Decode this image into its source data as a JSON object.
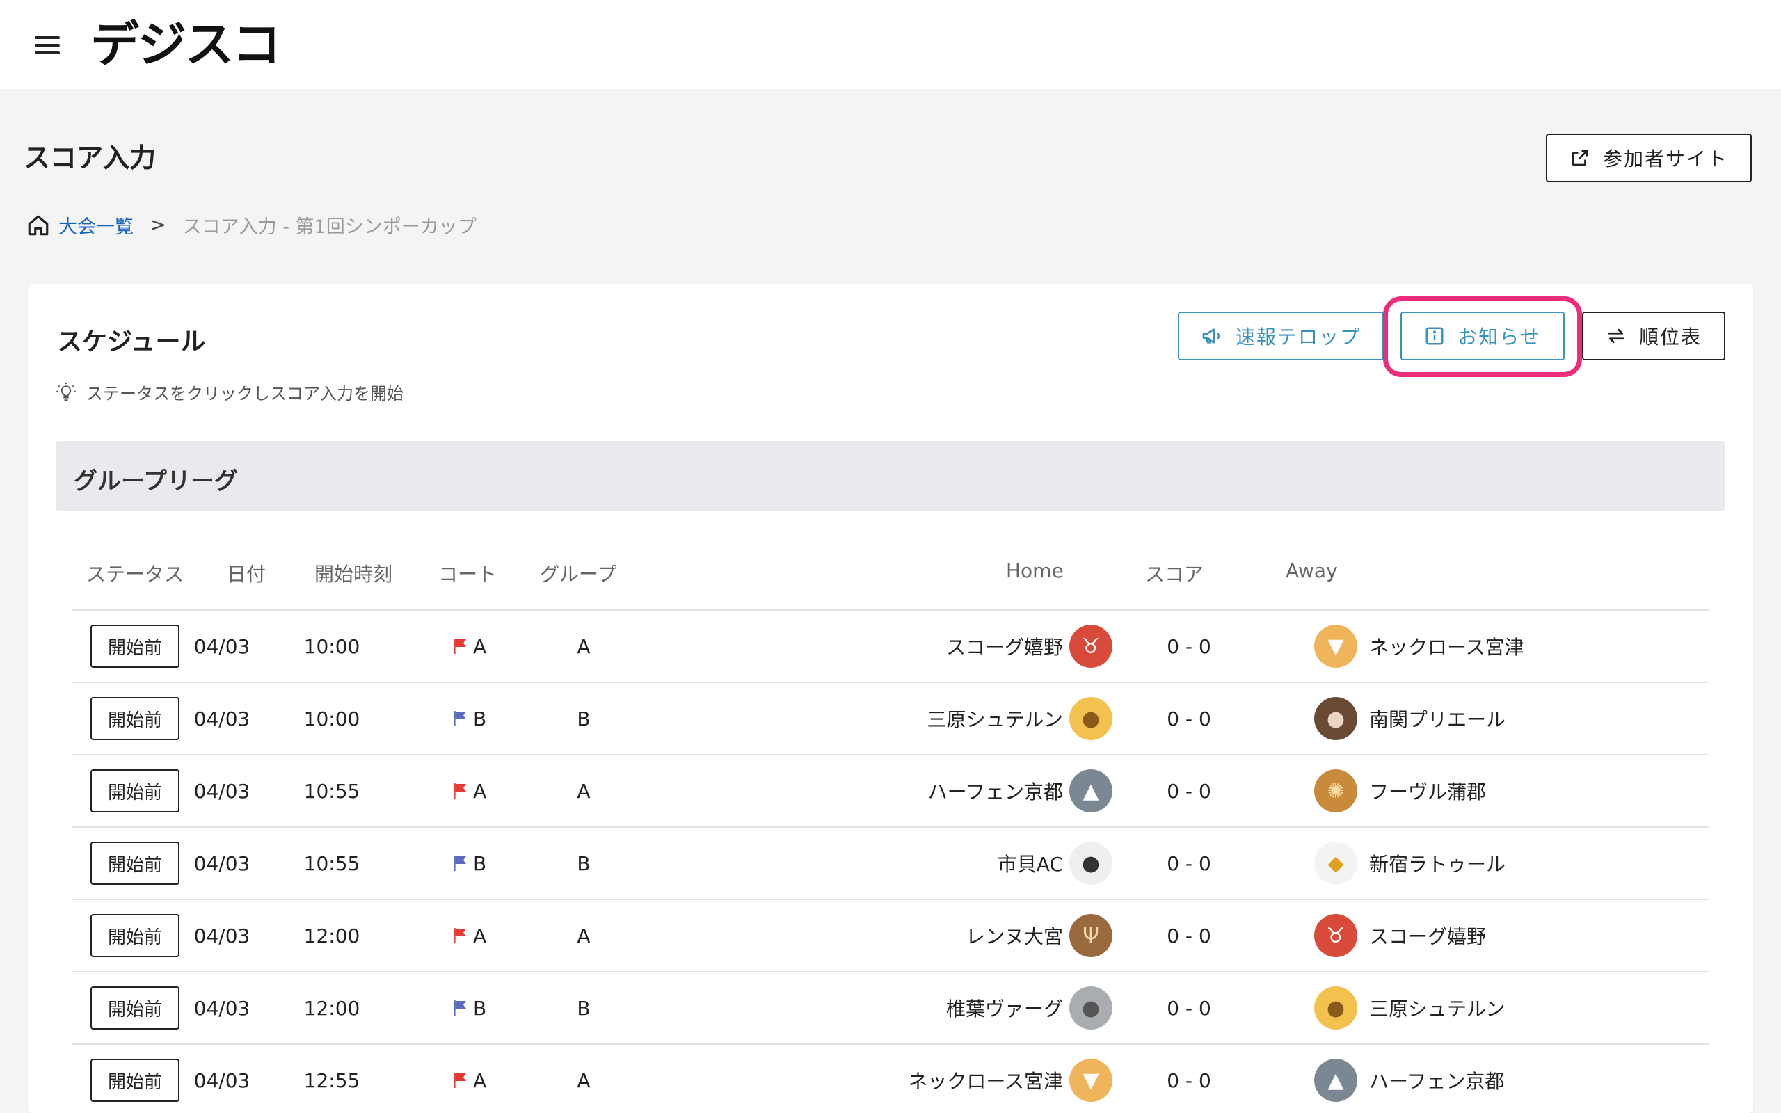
{
  "app": {
    "logo_text": "デジスコ",
    "menu_icon": "hamburger-menu-icon"
  },
  "page": {
    "title": "スコア入力",
    "participant_button": "参加者サイト"
  },
  "breadcrumb": {
    "home": "大会一覧",
    "separator": ">",
    "current": "スコア入力 - 第1回シンポーカップ"
  },
  "schedule": {
    "title": "スケジュール",
    "hint": "ステータスをクリックしスコア入力を開始",
    "buttons": {
      "telop": "速報テロップ",
      "notice": "お知らせ",
      "standings": "順位表"
    },
    "group_title": "グループリーグ",
    "columns": {
      "status": "ステータス",
      "date": "日付",
      "time": "開始時刻",
      "court": "コート",
      "group": "グループ",
      "home": "Home",
      "score": "スコア",
      "away": "Away"
    },
    "colors": {
      "court_a": "#e53935",
      "court_b": "#5c6bc0",
      "accent": "#3a93bf",
      "highlight": "#ec2d7b"
    },
    "matches": [
      {
        "status": "開始前",
        "date": "04/03",
        "time": "10:00",
        "court": "A",
        "group": "A",
        "home": "スコーグ嬉野",
        "home_emblem": "bull-icon",
        "score": "0 - 0",
        "away": "ネックロース宮津",
        "away_emblem": "fox-icon"
      },
      {
        "status": "開始前",
        "date": "04/03",
        "time": "10:00",
        "court": "B",
        "group": "B",
        "home": "三原シュテルン",
        "home_emblem": "giraffe-icon",
        "score": "0 - 0",
        "away": "南関プリエール",
        "away_emblem": "bear-icon"
      },
      {
        "status": "開始前",
        "date": "04/03",
        "time": "10:55",
        "court": "A",
        "group": "A",
        "home": "ハーフェン京都",
        "home_emblem": "wolf-icon",
        "score": "0 - 0",
        "away": "フーヴル蒲郡",
        "away_emblem": "lion-icon"
      },
      {
        "status": "開始前",
        "date": "04/03",
        "time": "10:55",
        "court": "B",
        "group": "B",
        "home": "市貝AC",
        "home_emblem": "polar-bear-icon",
        "score": "0 - 0",
        "away": "新宿ラトゥール",
        "away_emblem": "eagle-icon"
      },
      {
        "status": "開始前",
        "date": "04/03",
        "time": "12:00",
        "court": "A",
        "group": "A",
        "home": "レンヌ大宮",
        "home_emblem": "deer-icon",
        "score": "0 - 0",
        "away": "スコーグ嬉野",
        "away_emblem": "bull-icon"
      },
      {
        "status": "開始前",
        "date": "04/03",
        "time": "12:00",
        "court": "B",
        "group": "B",
        "home": "椎葉ヴァーグ",
        "home_emblem": "koala-icon",
        "score": "0 - 0",
        "away": "三原シュテルン",
        "away_emblem": "giraffe-icon"
      },
      {
        "status": "開始前",
        "date": "04/03",
        "time": "12:55",
        "court": "A",
        "group": "A",
        "home": "ネックロース宮津",
        "home_emblem": "fox-icon",
        "score": "0 - 0",
        "away": "ハーフェン京都",
        "away_emblem": "wolf-icon"
      }
    ]
  }
}
